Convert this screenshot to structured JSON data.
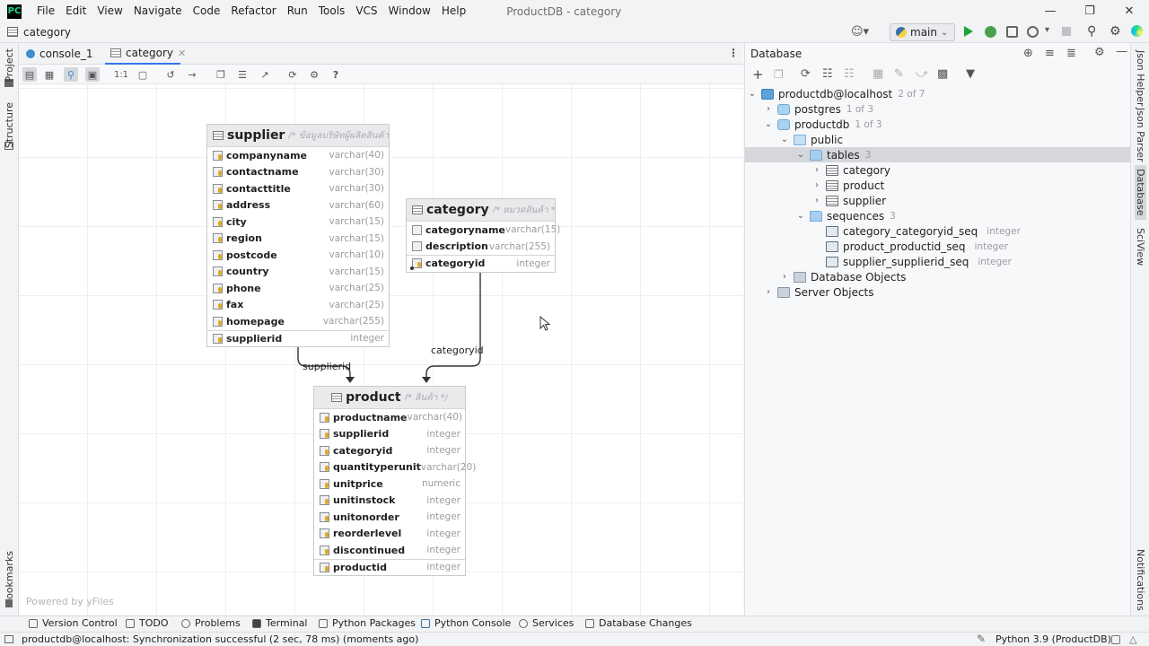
{
  "app": {
    "logo": "PC",
    "title": "ProductDB - category"
  },
  "menu": [
    "File",
    "Edit",
    "View",
    "Navigate",
    "Code",
    "Refactor",
    "Run",
    "Tools",
    "VCS",
    "Window",
    "Help"
  ],
  "navbar": {
    "breadcrumb": "category",
    "branch": "main"
  },
  "left_stripe": {
    "project": "Project",
    "structure": "Structure",
    "bookmarks": "Bookmarks"
  },
  "right_stripe": {
    "json_helper": "Json Helper",
    "json_parser": "Json Parser",
    "database": "Database",
    "sciview": "SciView",
    "notifications": "Notifications"
  },
  "editor_tabs": [
    {
      "label": "console_1"
    },
    {
      "label": "category"
    }
  ],
  "diagram": {
    "powered_by": "Powered by yFiles",
    "diagram_toolbar_ratio": "1:1",
    "help": "?",
    "tables": {
      "supplier": {
        "name": "supplier",
        "comment": "/* ข้อมูลบริษัทผู้ผลิตสินค้า */",
        "columns": [
          {
            "name": "companyname",
            "type": "varchar(40)"
          },
          {
            "name": "contactname",
            "type": "varchar(30)"
          },
          {
            "name": "contacttitle",
            "type": "varchar(30)"
          },
          {
            "name": "address",
            "type": "varchar(60)"
          },
          {
            "name": "city",
            "type": "varchar(15)"
          },
          {
            "name": "region",
            "type": "varchar(15)"
          },
          {
            "name": "postcode",
            "type": "varchar(10)"
          },
          {
            "name": "country",
            "type": "varchar(15)"
          },
          {
            "name": "phone",
            "type": "varchar(25)"
          },
          {
            "name": "fax",
            "type": "varchar(25)"
          },
          {
            "name": "homepage",
            "type": "varchar(255)"
          }
        ],
        "pk": {
          "name": "supplierid",
          "type": "integer"
        }
      },
      "category": {
        "name": "category",
        "comment": "/* หมวดสินค้า */",
        "columns": [
          {
            "name": "categoryname",
            "type": "varchar(15)"
          },
          {
            "name": "description",
            "type": "varchar(255)"
          }
        ],
        "pk": {
          "name": "categoryid",
          "type": "integer"
        }
      },
      "product": {
        "name": "product",
        "comment": "/* สินค้า */",
        "columns": [
          {
            "name": "productname",
            "type": "varchar(40)"
          },
          {
            "name": "supplierid",
            "type": "integer"
          },
          {
            "name": "categoryid",
            "type": "integer"
          },
          {
            "name": "quantityperunit",
            "type": "varchar(20)"
          },
          {
            "name": "unitprice",
            "type": "numeric"
          },
          {
            "name": "unitinstock",
            "type": "integer"
          },
          {
            "name": "unitonorder",
            "type": "integer"
          },
          {
            "name": "reorderlevel",
            "type": "integer"
          },
          {
            "name": "discontinued",
            "type": "integer"
          }
        ],
        "pk": {
          "name": "productid",
          "type": "integer"
        }
      }
    },
    "edges": {
      "supplier_product": "supplierid",
      "category_product": "categoryid"
    }
  },
  "database_panel": {
    "title": "Database",
    "tree": {
      "connection": {
        "label": "productdb@localhost",
        "count": "2 of 7"
      },
      "postgres": {
        "label": "postgres",
        "count": "1 of 3"
      },
      "productdb": {
        "label": "productdb",
        "count": "1 of 3"
      },
      "public": {
        "label": "public"
      },
      "tables": {
        "label": "tables",
        "count": "3"
      },
      "tables_list": [
        "category",
        "product",
        "supplier"
      ],
      "sequences": {
        "label": "sequences",
        "count": "3"
      },
      "sequences_list": [
        {
          "name": "category_categoryid_seq",
          "type": "integer"
        },
        {
          "name": "product_productid_seq",
          "type": "integer"
        },
        {
          "name": "supplier_supplierid_seq",
          "type": "integer"
        }
      ],
      "database_objects": {
        "label": "Database Objects"
      },
      "server_objects": {
        "label": "Server Objects"
      }
    }
  },
  "tool_windows": [
    "Version Control",
    "TODO",
    "Problems",
    "Terminal",
    "Python Packages",
    "Python Console",
    "Services",
    "Database Changes"
  ],
  "status": {
    "message": "productdb@localhost: Synchronization successful (2 sec, 78 ms) (moments ago)",
    "interpreter": "Python 3.9 (ProductDB)"
  },
  "colors": {
    "accent": "#3574f0",
    "run_green": "#1fa33b",
    "key_yellow": "#e0a928"
  }
}
